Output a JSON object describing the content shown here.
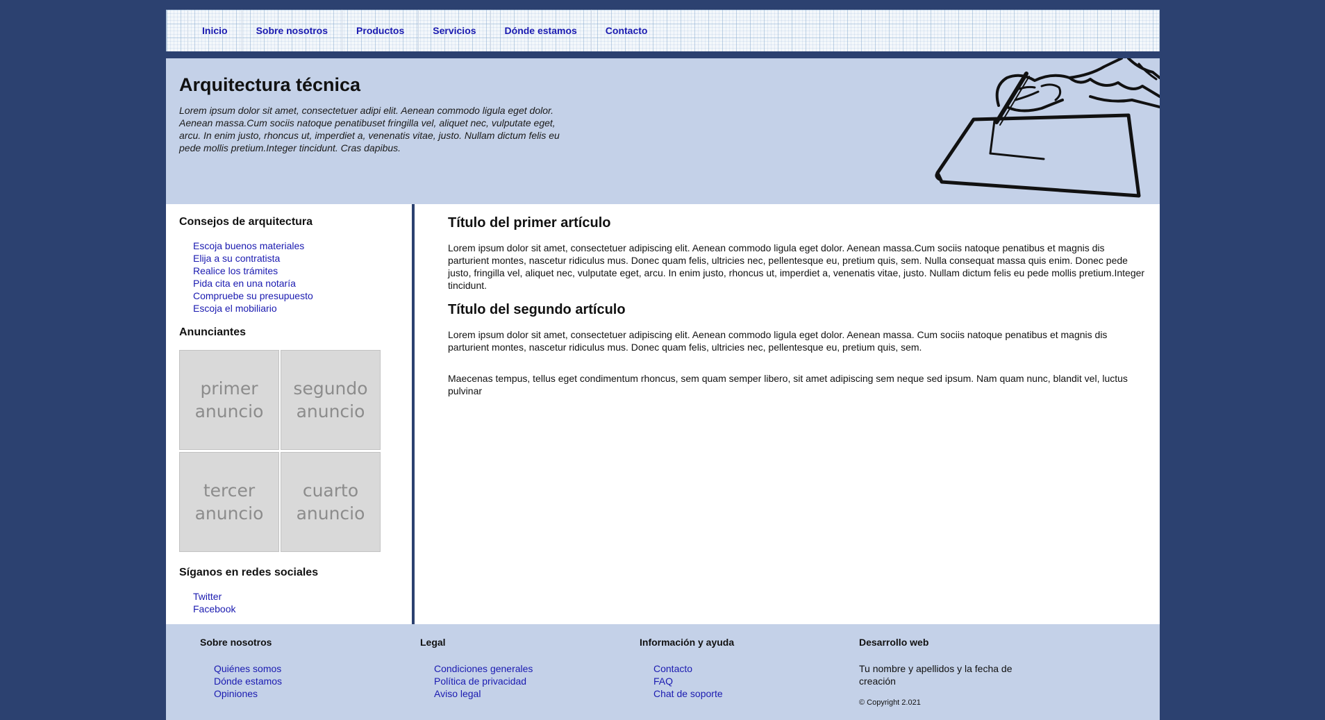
{
  "nav": {
    "items": [
      "Inicio",
      "Sobre nosotros",
      "Productos",
      "Servicios",
      "Dónde estamos",
      "Contacto"
    ]
  },
  "header": {
    "title": "Arquitectura técnica",
    "intro": "Lorem ipsum dolor sit amet, consectetuer adipi elit. Aenean commodo ligula eget dolor. Aenean massa.Cum sociis natoque penatibuset fringilla vel, aliquet nec, vulputate eget, arcu. In enim justo, rhoncus ut, imperdiet a, venenatis vitae, justo. Nullam dictum felis eu pede mollis pretium.Integer tincidunt. Cras dapibus.",
    "illustration_icon": "drawing-hand-icon"
  },
  "sidebar": {
    "tips_heading": "Consejos de arquitectura",
    "tips": [
      "Escoja buenos materiales",
      "Elija a su contratista",
      "Realice los trámites",
      "Pida cita en una notaría",
      "Compruebe su presupuesto",
      "Escoja el mobiliario"
    ],
    "ads_heading": "Anunciantes",
    "ads": [
      "primer\nanuncio",
      "segundo\nanuncio",
      "tercer\nanuncio",
      "cuarto\nanuncio"
    ],
    "social_heading": "Síganos en redes sociales",
    "social": [
      "Twitter",
      "Facebook"
    ]
  },
  "main": {
    "article1_title": "Título del primer artículo",
    "article1_body": "Lorem ipsum dolor sit amet, consectetuer adipiscing elit. Aenean commodo ligula eget dolor. Aenean massa.Cum sociis natoque penatibus et magnis dis parturient montes, nascetur ridiculus mus. Donec quam felis, ultricies nec, pellentesque eu, pretium quis, sem. Nulla consequat massa quis enim. Donec pede justo, fringilla vel, aliquet nec, vulputate eget, arcu. In enim justo, rhoncus ut, imperdiet a, venenatis vitae, justo. Nullam dictum felis eu pede mollis pretium.Integer tincidunt.",
    "article2_title": "Título del segundo artículo",
    "article2_body1": "Lorem ipsum dolor sit amet, consectetuer adipiscing elit. Aenean commodo ligula eget dolor. Aenean massa. Cum sociis natoque penatibus et magnis dis parturient montes, nascetur ridiculus mus. Donec quam felis, ultricies nec, pellentesque eu, pretium quis, sem.",
    "article2_body2": "Maecenas tempus, tellus eget condimentum rhoncus, sem quam semper libero, sit amet adipiscing sem neque sed ipsum. Nam quam nunc, blandit vel, luctus pulvinar"
  },
  "footer": {
    "about_heading": "Sobre nosotros",
    "about_links": [
      "Quiénes somos",
      "Dónde estamos",
      "Opiniones"
    ],
    "legal_heading": "Legal",
    "legal_links": [
      "Condiciones generales",
      "Política de privacidad",
      "Aviso legal"
    ],
    "help_heading": "Información y ayuda",
    "help_links": [
      "Contacto",
      "FAQ",
      "Chat de soporte"
    ],
    "dev_heading": "Desarrollo web",
    "dev_note": "Tu nombre y apellidos y la fecha de creación",
    "copyright": "© Copyright 2.021"
  },
  "colors": {
    "background": "#2c4170",
    "header_band": "#c4d1e8",
    "link": "#1a1ab0",
    "ad_box": "#d9d9d9"
  }
}
